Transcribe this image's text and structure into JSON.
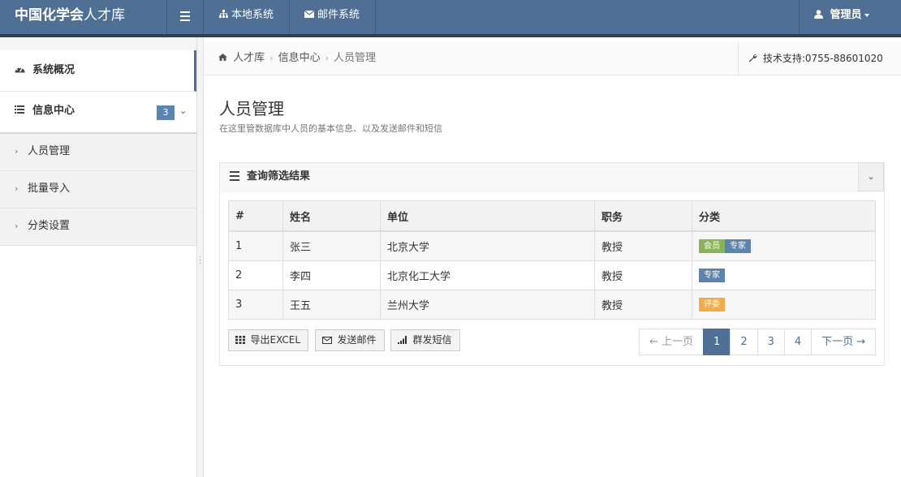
{
  "topbar": {
    "brand_bold": "中国化学会",
    "brand_rest": "人才库",
    "nav": [
      {
        "label": "本地系统",
        "icon": "sitemap-icon"
      },
      {
        "label": "邮件系统",
        "icon": "envelope-icon"
      }
    ],
    "user_label": "管理员"
  },
  "sidebar": {
    "overview_label": "系统概况",
    "info_center_label": "信息中心",
    "info_center_count": "3",
    "items": [
      {
        "label": "人员管理"
      },
      {
        "label": "批量导入"
      },
      {
        "label": "分类设置"
      }
    ]
  },
  "breadcrumb": {
    "home": "人才库",
    "section": "信息中心",
    "current": "人员管理"
  },
  "support_text": "技术支持:0755-88601020",
  "page": {
    "title": "人员管理",
    "subtitle": "在这里管数据库中人员的基本信息、以及发送邮件和短信"
  },
  "panel": {
    "title": "查询筛选结果"
  },
  "table": {
    "headers": [
      "#",
      "姓名",
      "单位",
      "职务",
      "分类"
    ],
    "rows": [
      {
        "num": "1",
        "name": "张三",
        "unit": "北京大学",
        "position": "教授",
        "tags": [
          {
            "text": "会员",
            "color": "#8bb35a"
          },
          {
            "text": "专家",
            "color": "#5b84b1"
          }
        ]
      },
      {
        "num": "2",
        "name": "李四",
        "unit": "北京化工大学",
        "position": "教授",
        "tags": [
          {
            "text": "专家",
            "color": "#5b84b1"
          }
        ]
      },
      {
        "num": "3",
        "name": "王五",
        "unit": "兰州大学",
        "position": "教授",
        "tags": [
          {
            "text": "评委",
            "color": "#f0ad4e"
          }
        ]
      }
    ]
  },
  "actions": {
    "export_label": "导出EXCEL",
    "email_label": "发送邮件",
    "sms_label": "群发短信"
  },
  "pagination": {
    "prev": "← 上一页",
    "pages": [
      "1",
      "2",
      "3",
      "4"
    ],
    "current": "1",
    "next": "下一页 →"
  },
  "colors": {
    "accent": "#4f6f94",
    "topbar_border": "#2b3f55",
    "badge": "#5b84b1"
  }
}
